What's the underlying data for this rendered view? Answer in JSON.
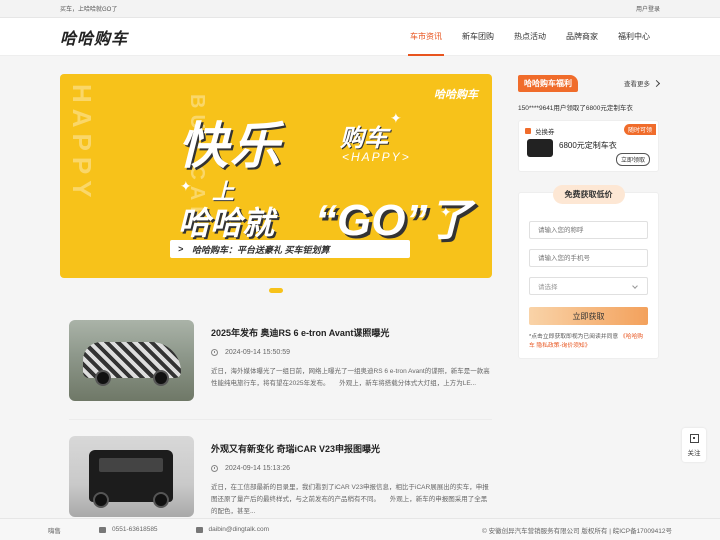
{
  "topbar": {
    "left": "买车，上哈哈就GO了",
    "right": "用户登录"
  },
  "header": {
    "logo": "哈哈购车",
    "nav": [
      "车市资讯",
      "新车团购",
      "热点活动",
      "品牌商家",
      "福利中心"
    ]
  },
  "banner": {
    "logo": "哈哈购车",
    "bg_left": "HAPPY",
    "bg_right": "BUY CAR",
    "line1": "快乐",
    "line1b": "购车",
    "happy": "<HAPPY>",
    "shang": "上",
    "line2": "哈哈就",
    "go": "“GO”了",
    "slogan": "哈哈购车：平台送豪礼 买车钜划算"
  },
  "news": [
    {
      "title": "2025年发布 奥迪RS 6 e-tron Avant谍照曝光",
      "time": "2024-09-14 15:50:59",
      "desc": "近日，海外媒体曝光了一组日前，网络上曝光了一组奥迪RS 6 e-tron Avant的谍照，新车是一款高性能纯电旅行车，将有望在2025年发布。　　外观上，新车将搭载分体式大灯组，上方为LE..."
    },
    {
      "title": "外观又有新变化 奇瑞iCAR V23申报图曝光",
      "time": "2024-09-14 15:13:26",
      "desc": "近日，在工信部最新的目录里，我们看到了iCAR V23申报信息，相比于iCAR展展出的实车，申报图还原了量产后的最终样式，与之前发布的产品稍有不同。　　外观上，新车的申报图采用了全黑的配色，甚至..."
    }
  ],
  "side": {
    "fuli_tag": "哈哈购车福利",
    "more": "查看更多",
    "msg": "150****9641用户领取了6800元定制车衣",
    "coupon": {
      "label": "兑换券",
      "badge": "随时可领",
      "text": "6800元定制车衣",
      "button": "立即领取"
    },
    "form": {
      "title": "免费获取低价",
      "name_placeholder": "请输入您的称呼",
      "phone_placeholder": "请输入您的手机号",
      "select_placeholder": "请选择",
      "submit": "立即获取",
      "agree_text": "*点击立即获取即视为已阅读并同意",
      "agree_link": "《哈哈购车 隐私政策-询价须知》"
    }
  },
  "follow": {
    "label": "关注"
  },
  "footer": {
    "company_short": "嗨售",
    "phone": "0551-63618585",
    "email": "daibin@dingtalk.com",
    "copyright": "© 安徽创异汽车营销服务有限公司 版权所有 | 皖ICP备17009412号"
  },
  "colors": {
    "accent": "#e8541e",
    "banner": "#f7c21a"
  }
}
